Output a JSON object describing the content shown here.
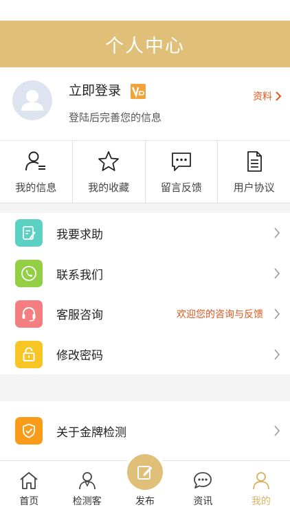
{
  "header": {
    "title": "个人中心"
  },
  "profile": {
    "login_title": "立即登录",
    "vip_badge": "VIP",
    "subtitle": "登陆后完善您的信息",
    "link_label": "资料"
  },
  "quick": [
    {
      "label": "我的信息",
      "icon": "user-list-icon"
    },
    {
      "label": "我的收藏",
      "icon": "star-icon"
    },
    {
      "label": "留言反馈",
      "icon": "chat-bubble-icon"
    },
    {
      "label": "用户协议",
      "icon": "document-icon"
    }
  ],
  "menu": [
    {
      "label": "我要求助",
      "note": "",
      "icon": "edit-note-icon",
      "color": "#5ad1c3"
    },
    {
      "label": "联系我们",
      "note": "",
      "icon": "phone-icon",
      "color": "#93cf45"
    },
    {
      "label": "客服咨询",
      "note": "欢迎您的咨询与反馈",
      "icon": "headset-icon",
      "color": "#f57f80"
    },
    {
      "label": "修改密码",
      "note": "",
      "icon": "lock-icon",
      "color": "#f8c624"
    }
  ],
  "menu2": [
    {
      "label": "关于金牌检测",
      "icon": "shield-check-icon",
      "color": "#fa9b1a"
    }
  ],
  "tabbar": [
    {
      "label": "首页",
      "icon": "home-icon"
    },
    {
      "label": "检测客",
      "icon": "person-icon"
    },
    {
      "label": "发布",
      "icon": "edit-icon"
    },
    {
      "label": "资讯",
      "icon": "chat-dots-icon"
    },
    {
      "label": "我的",
      "icon": "person-active-icon",
      "active": true
    }
  ],
  "colors": {
    "accent": "#e0bf78",
    "link": "#e0561c"
  }
}
